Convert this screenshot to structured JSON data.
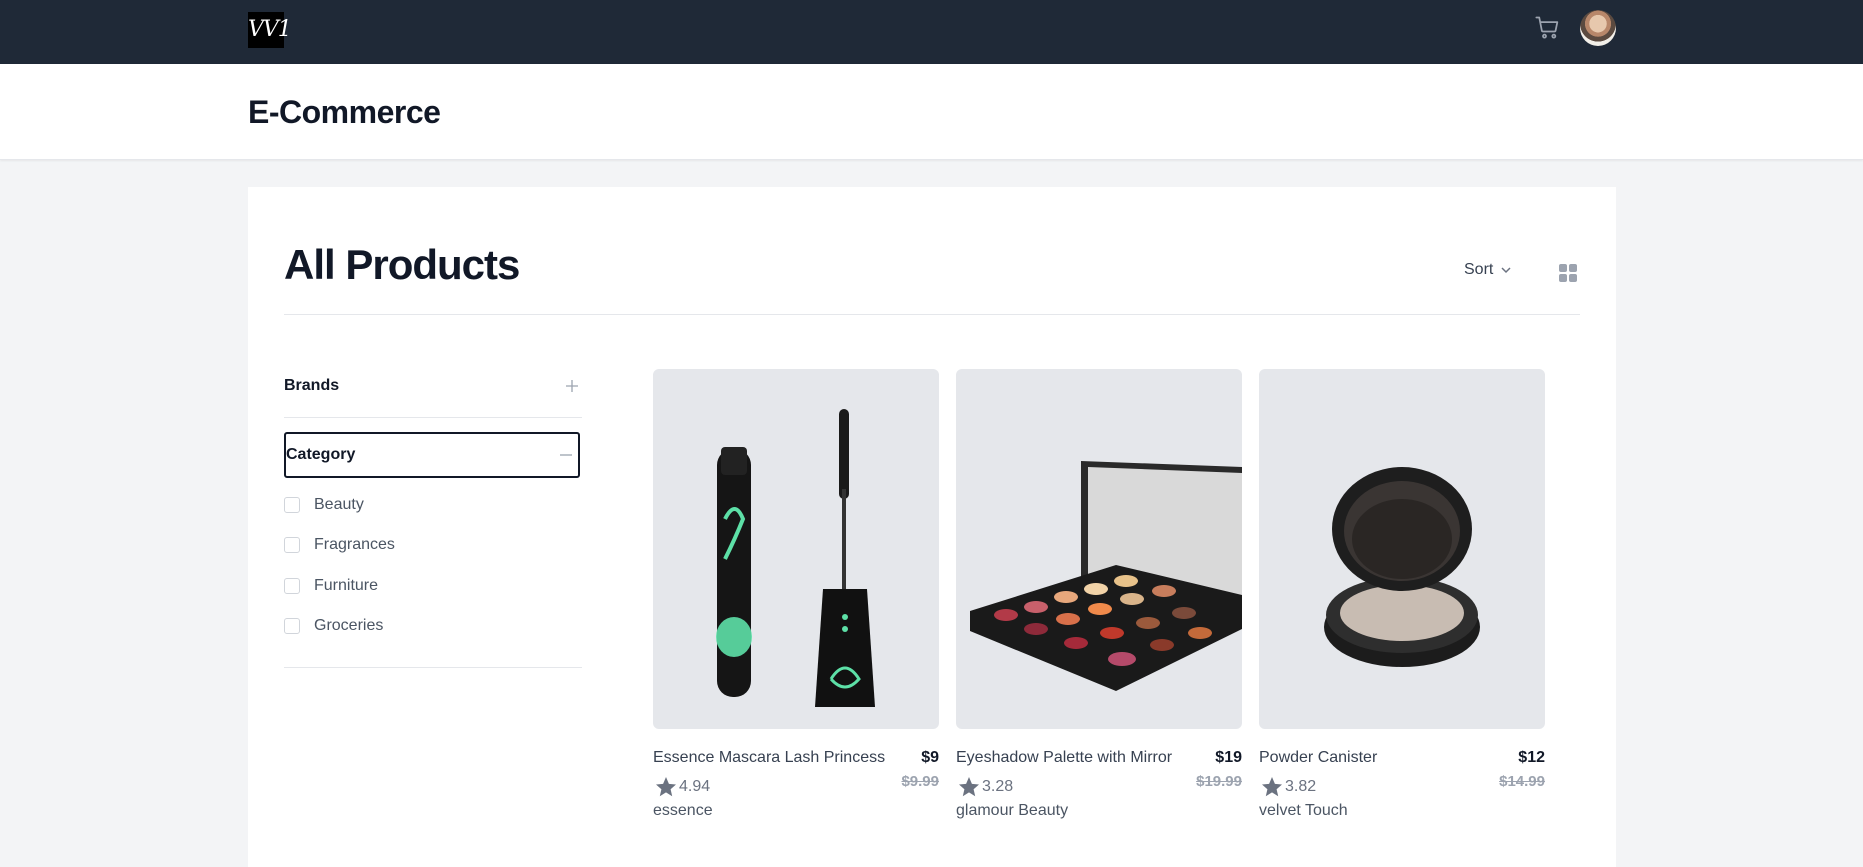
{
  "app": {
    "logo_text": "VV1"
  },
  "header": {
    "title": "E-Commerce"
  },
  "products_panel": {
    "title": "All Products",
    "sort_label": "Sort"
  },
  "filters": {
    "brands_label": "Brands",
    "category_label": "Category",
    "categories": [
      "Beauty",
      "Fragrances",
      "Furniture",
      "Groceries"
    ]
  },
  "products": [
    {
      "name": "Essence Mascara Lash Princess",
      "price": "$9",
      "old_price": "$9.99",
      "rating": "4.94",
      "brand": "essence"
    },
    {
      "name": "Eyeshadow Palette with Mirror",
      "price": "$19",
      "old_price": "$19.99",
      "rating": "3.28",
      "brand": "glamour Beauty"
    },
    {
      "name": "Powder Canister",
      "price": "$12",
      "old_price": "$14.99",
      "rating": "3.82",
      "brand": "velvet Touch"
    }
  ],
  "icons": {
    "cart": "cart-icon",
    "sort": "chevron-down-icon",
    "grid": "grid-view-icon",
    "expand": "plus-icon",
    "collapse": "minus-icon",
    "star": "star-icon"
  },
  "colors": {
    "topbar": "#1f2937",
    "background": "#f3f4f6",
    "thumb_bg": "#e5e7eb"
  }
}
